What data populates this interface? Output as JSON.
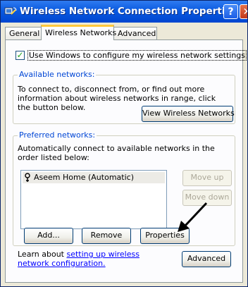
{
  "window": {
    "title": "Wireless Network Connection Properties",
    "help_glyph": "?",
    "close_glyph": "✕",
    "icon": "network-connection-icon"
  },
  "tabs": [
    {
      "label": "General",
      "active": false
    },
    {
      "label": "Wireless Networks",
      "active": true
    },
    {
      "label": "Advanced",
      "active": false
    }
  ],
  "use_windows": {
    "label": "Use Windows to configure my wireless network settings",
    "checked": true
  },
  "available": {
    "title": "Available networks:",
    "description": "To connect to, disconnect from, or find out more information about wireless networks in range, click the button below.",
    "view_button": "View Wireless Networks"
  },
  "preferred": {
    "title": "Preferred networks:",
    "description": "Automatically connect to available networks in the order listed below:",
    "networks": [
      {
        "name": "Aseem Home (Automatic)"
      }
    ],
    "move_up": "Move up",
    "move_down": "Move down",
    "add": "Add...",
    "remove": "Remove",
    "properties": "Properties"
  },
  "learn": {
    "prefix": "Learn about ",
    "link": "setting up wireless network configuration.",
    "advanced_button": "Advanced"
  },
  "colors": {
    "title_bar": "#0a5ae0",
    "accent_link": "#0000ff",
    "group_title": "#0046d5",
    "active_tab_highlight": "#ffc83c"
  }
}
